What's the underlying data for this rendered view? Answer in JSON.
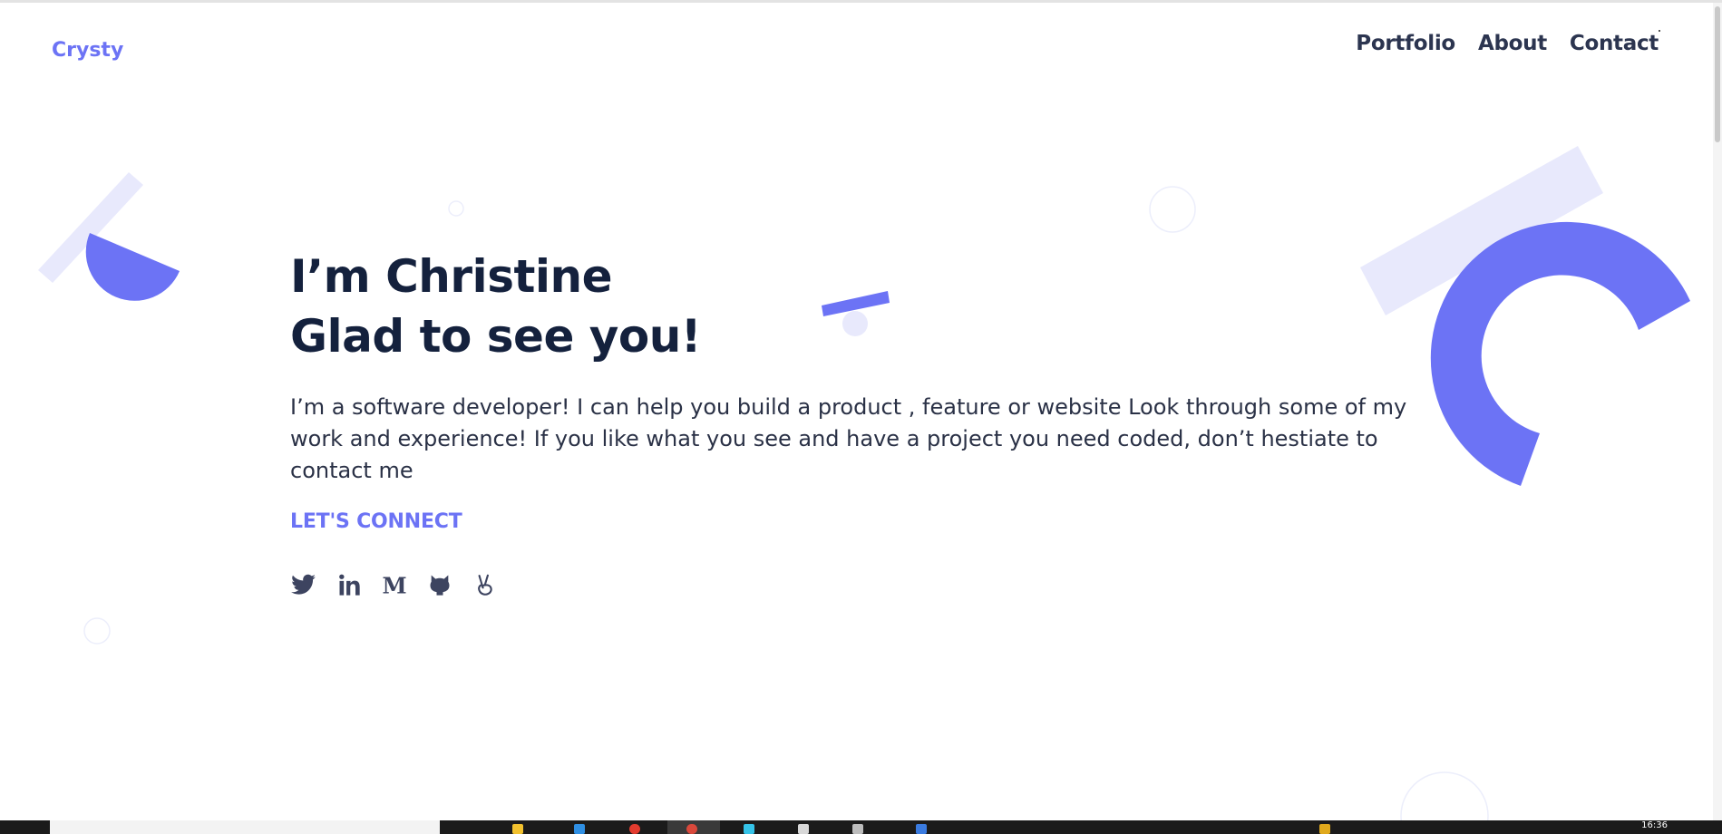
{
  "header": {
    "logo": "Crysty",
    "nav": [
      "Portfolio",
      "About",
      "Contact"
    ]
  },
  "hero": {
    "line1": "I’m Christine",
    "line2": "Glad to see you!",
    "intro": "I’m a software developer! I can help you build a product , feature or website Look through some of my work and experience! If you like what you see and have a project you need coded, don’t hestiate to contact me",
    "connect": "LET'S CONNECT"
  },
  "socials": [
    "twitter-icon",
    "linkedin-icon",
    "medium-icon",
    "github-icon",
    "angellist-icon"
  ],
  "colors": {
    "accent": "#6c73f5",
    "accent_light": "#e8e9fc",
    "heading": "#14213d",
    "body_text": "#2a3146",
    "nav_text": "#2c3550"
  },
  "taskbar": {
    "clock": "16:36"
  }
}
